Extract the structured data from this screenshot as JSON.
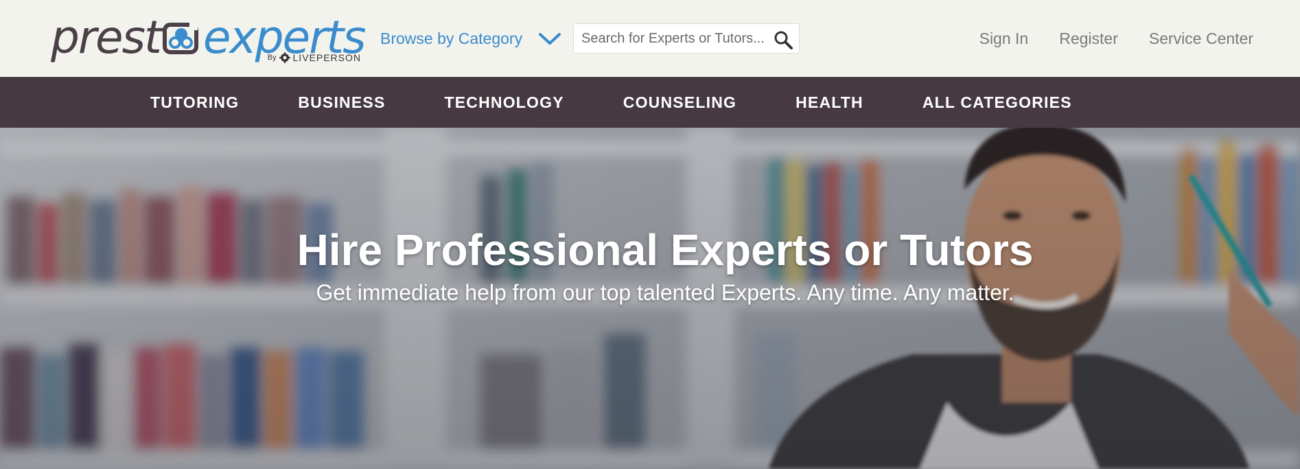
{
  "brand": {
    "logo_text_left": "prest",
    "logo_text_right": "experts",
    "logo_by": "By",
    "logo_partner": "LIVEPERSON",
    "color_dark": "#4b3f48",
    "color_blue": "#3a8ccc"
  },
  "header": {
    "browse_label": "Browse by Category",
    "browse_icon": "chevron-down-icon",
    "search": {
      "placeholder": "Search for Experts or Tutors...",
      "value": "",
      "icon": "search-icon"
    },
    "links": {
      "sign_in": "Sign In",
      "register": "Register",
      "service_center": "Service Center"
    }
  },
  "nav": {
    "items": [
      {
        "label": "TUTORING"
      },
      {
        "label": "BUSINESS"
      },
      {
        "label": "TECHNOLOGY"
      },
      {
        "label": "COUNSELING"
      },
      {
        "label": "HEALTH"
      },
      {
        "label": "ALL CATEGORIES"
      }
    ],
    "background": "#463941"
  },
  "hero": {
    "title": "Hire Professional Experts or Tutors",
    "subtitle": "Get immediate help from our top talented Experts. Any time. Any matter."
  }
}
